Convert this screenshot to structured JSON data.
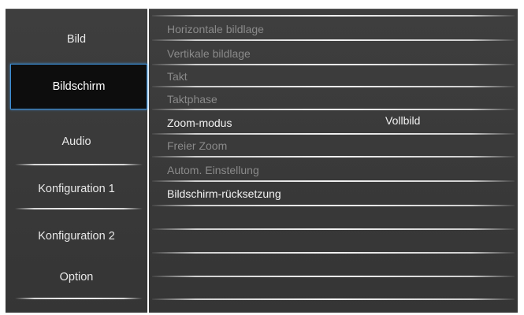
{
  "left_menu": {
    "items": [
      {
        "label": "Bild"
      },
      {
        "label": "Bildschirm",
        "selected": true
      },
      {
        "label": "Audio"
      },
      {
        "label": "Konfiguration 1"
      },
      {
        "label": "Konfiguration 2"
      },
      {
        "label": "Option"
      }
    ]
  },
  "settings": {
    "items": [
      {
        "label": "Horizontale bildlage",
        "enabled": false
      },
      {
        "label": "Vertikale bildlage",
        "enabled": false
      },
      {
        "label": "Takt",
        "enabled": false
      },
      {
        "label": "Taktphase",
        "enabled": false
      },
      {
        "label": "Zoom-modus",
        "value": "Vollbild",
        "enabled": true
      },
      {
        "label": "Freier Zoom",
        "enabled": false
      },
      {
        "label": "Autom. Einstellung",
        "enabled": false
      },
      {
        "label": "Bildschirm-rücksetzung",
        "enabled": true
      }
    ]
  },
  "colors": {
    "panel_background": "#3a3a3a",
    "selected_background": "#0d0d0d",
    "selected_border": "#3d8fd6",
    "enabled_text": "#f2f2f2",
    "disabled_text": "#8a8a8a"
  }
}
